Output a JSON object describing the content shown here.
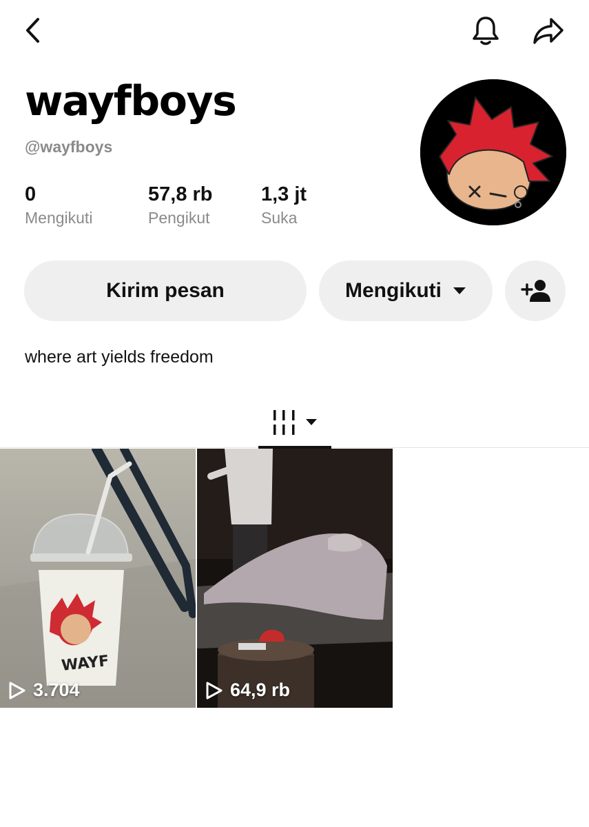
{
  "profile": {
    "display_name": "wayfboys",
    "handle": "@wayfboys",
    "bio": "where art yields freedom"
  },
  "stats": [
    {
      "value": "0",
      "label": "Mengikuti"
    },
    {
      "value": "57,8 rb",
      "label": "Pengikut"
    },
    {
      "value": "1,3 jt",
      "label": "Suka"
    }
  ],
  "actions": {
    "message_label": "Kirim pesan",
    "following_label": "Mengikuti"
  },
  "icons": {
    "back": "chevron-left-icon",
    "bell": "bell-icon",
    "share": "share-icon",
    "add_friend": "add-user-icon",
    "grid": "grid-icon",
    "play": "play-icon"
  },
  "videos": [
    {
      "views": "3.704"
    },
    {
      "views": "64,9 rb"
    }
  ],
  "colors": {
    "button_bg": "#efefef",
    "secondary_text": "#8a8a8a",
    "avatar_hair": "#d8222f",
    "avatar_bg": "#000000"
  }
}
